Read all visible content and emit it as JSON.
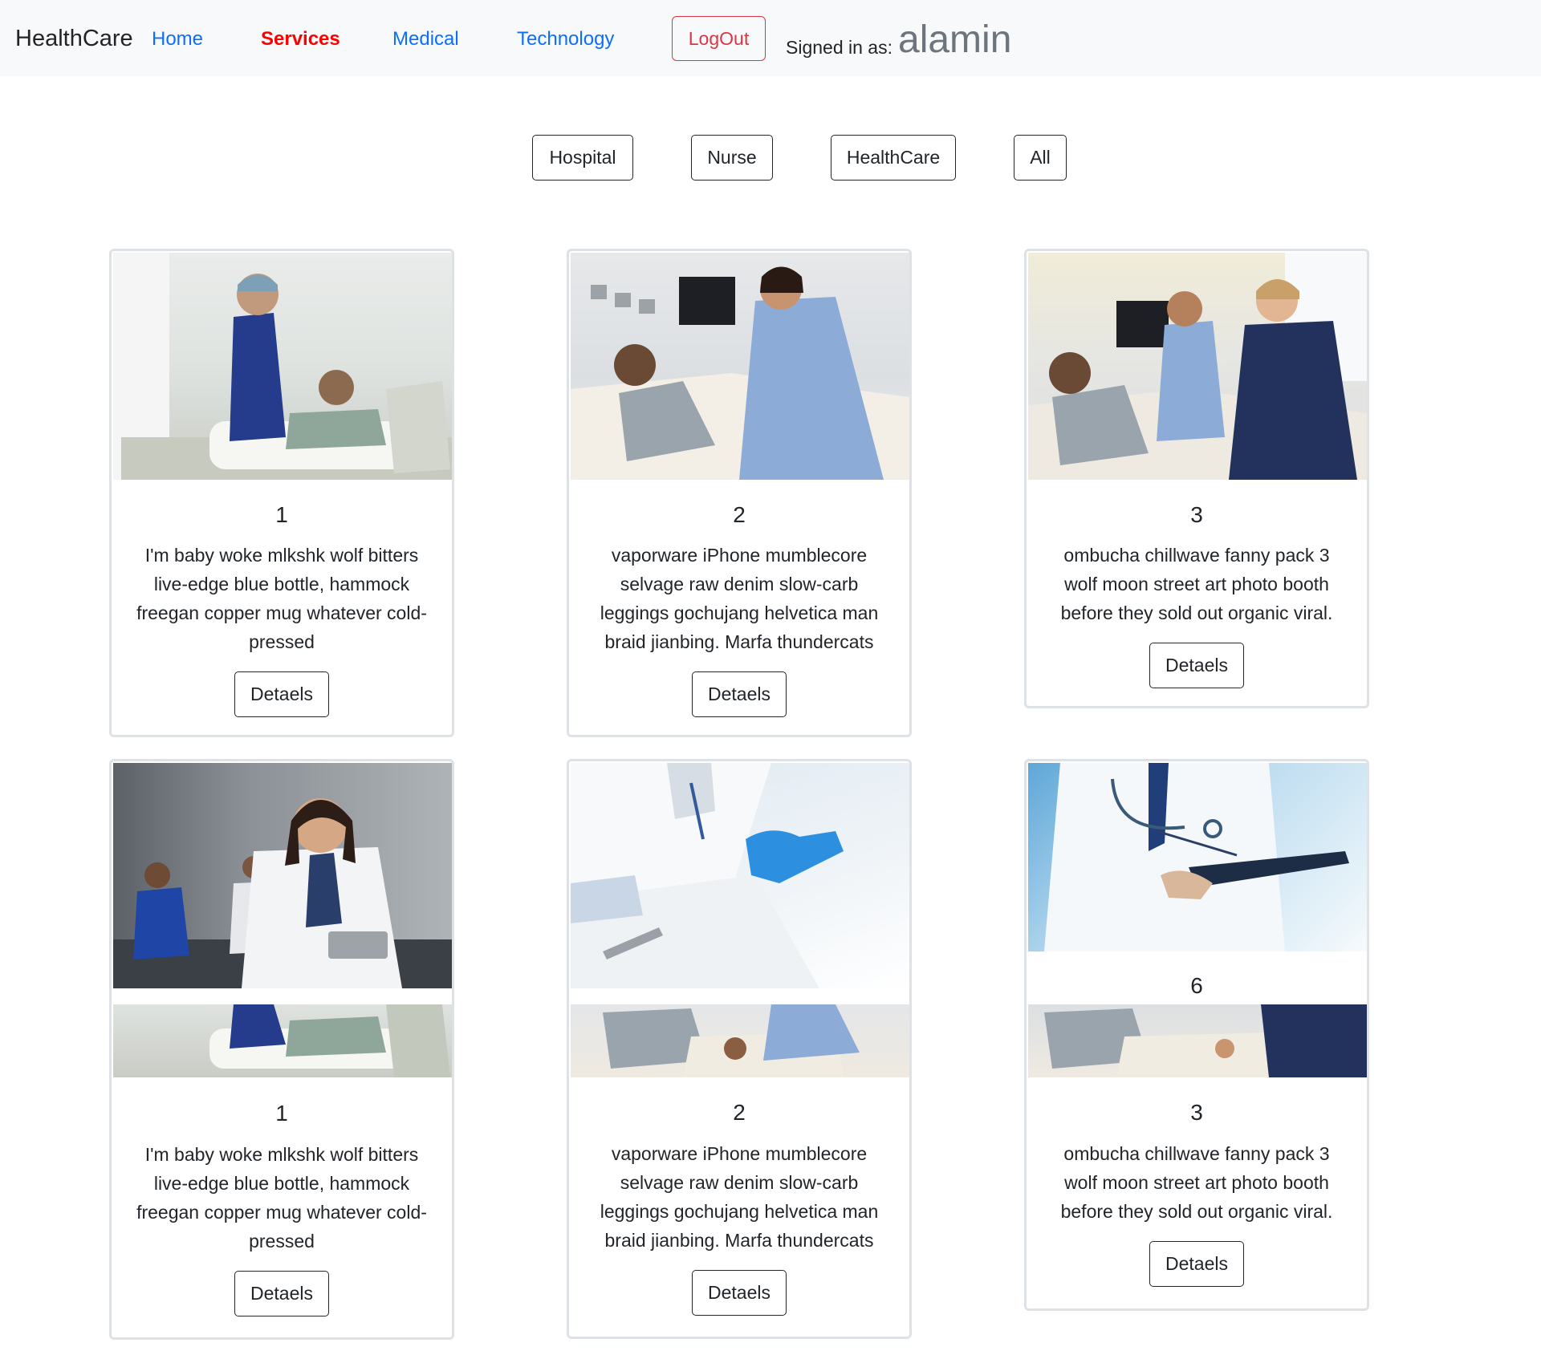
{
  "navbar": {
    "brand": "HealthCare",
    "links": [
      "Home",
      "Services",
      "Medical",
      "Technology"
    ],
    "logout_label": "LogOut",
    "signed_in_label": "Signed in as:",
    "username": "alamin"
  },
  "filters": [
    "Hospital",
    "Nurse",
    "HealthCare",
    "All"
  ],
  "cards": [
    {
      "title": "1",
      "text": "I'm baby woke mlkshk wolf bitters live-edge blue bottle, hammock freegan copper mug whatever cold-pressed",
      "button": "Detaels"
    },
    {
      "title": "2",
      "text": "vaporware iPhone mumblecore selvage raw denim slow-carb leggings gochujang helvetica man braid jianbing. Marfa thundercats",
      "button": "Detaels"
    },
    {
      "title": "3",
      "text": "ombucha chillwave fanny pack 3 wolf moon street art photo booth before they sold out organic viral.",
      "button": "Detaels"
    },
    {
      "title": "1",
      "text": "I'm baby woke mlkshk wolf bitters live-edge blue bottle, hammock freegan copper mug whatever cold-pressed",
      "button": "Detaels"
    },
    {
      "title": "2",
      "text": "vaporware iPhone mumblecore selvage raw denim slow-carb leggings gochujang helvetica man braid jianbing. Marfa thundercats",
      "button": "Detaels"
    },
    {
      "title": "3",
      "overlay_title": "6",
      "text": "ombucha chillwave fanny pack 3 wolf moon street art photo booth before they sold out organic viral.",
      "button": "Detaels"
    }
  ]
}
